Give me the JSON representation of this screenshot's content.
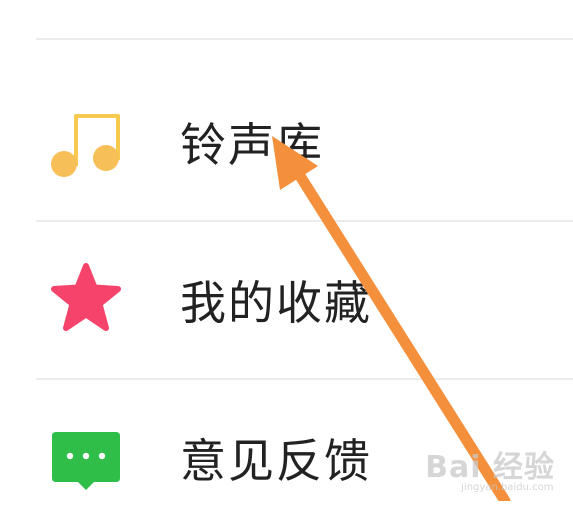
{
  "menu": {
    "items": [
      {
        "label": "铃声库",
        "icon": "music-note-icon",
        "icon_color": "#F7BF57"
      },
      {
        "label": "我的收藏",
        "icon": "star-icon",
        "icon_color": "#F5436B"
      },
      {
        "label": "意见反馈",
        "icon": "chat-bubble-icon",
        "icon_color": "#2FBE47"
      }
    ]
  },
  "annotation": {
    "arrow_color": "#F4903C",
    "points_to": "铃声库"
  },
  "watermark": {
    "text": "Bai 经验",
    "subtext": "jingyan.baidu.com"
  },
  "colors": {
    "background": "#FFFFFF",
    "divider": "#ECECEC",
    "label_text": "#222222"
  }
}
